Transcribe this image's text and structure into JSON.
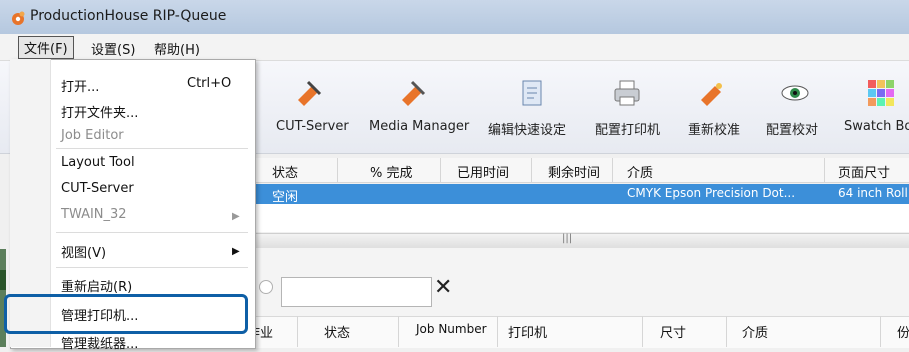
{
  "window": {
    "title": "ProductionHouse RIP-Queue"
  },
  "menubar": {
    "file": "文件(F)",
    "settings": "设置(S)",
    "help": "帮助(H)"
  },
  "toolbar": {
    "partial_left": "",
    "items": [
      {
        "label": "CUT-Server",
        "icon": "cut-server-pen-icon"
      },
      {
        "label": "Media Manager",
        "icon": "media-manager-pen-icon"
      },
      {
        "label": "编辑快速设定",
        "icon": "edit-quicksets-doc-icon"
      },
      {
        "label": "配置打印机",
        "icon": "printer-icon"
      },
      {
        "label": "重新校准",
        "icon": "recalibrate-icon"
      },
      {
        "label": "配置校对",
        "icon": "proof-eye-icon"
      },
      {
        "label": "Swatch Bo",
        "icon": "swatch-grid-icon"
      }
    ]
  },
  "queue": {
    "columns": [
      "状态",
      "% 完成",
      "已用时间",
      "剩余时间",
      "介质",
      "页面尺寸"
    ],
    "rows": [
      {
        "status": "空闲",
        "media": "CMYK Epson Precision Dot...",
        "size": "64 inch Roll"
      }
    ]
  },
  "splitter_grip": "|||",
  "jobs": {
    "search_value": "",
    "clear": "✕",
    "columns": [
      "作业",
      "状态",
      "Job Number",
      "打印机",
      "尺寸",
      "介质",
      "份"
    ]
  },
  "file_menu": {
    "items": [
      {
        "label": "打开...",
        "shortcut": "Ctrl+O",
        "disabled": false
      },
      {
        "label": "打开文件夹...",
        "disabled": false
      },
      {
        "label": "Job Editor",
        "disabled": true
      },
      {
        "label": "Layout Tool",
        "disabled": false
      },
      {
        "label": "CUT-Server",
        "disabled": false
      },
      {
        "label": "TWAIN_32",
        "disabled": true,
        "submenu": true
      },
      {
        "label": "视图(V)",
        "disabled": false,
        "submenu": true
      },
      {
        "label": "重新启动(R)",
        "disabled": false
      },
      {
        "label": "管理打印机...",
        "disabled": false
      },
      {
        "label": "管理裁纸器...",
        "disabled": false
      }
    ]
  },
  "colors": {
    "selection": "#3c8fd9",
    "highlight": "#0e5fa6"
  }
}
